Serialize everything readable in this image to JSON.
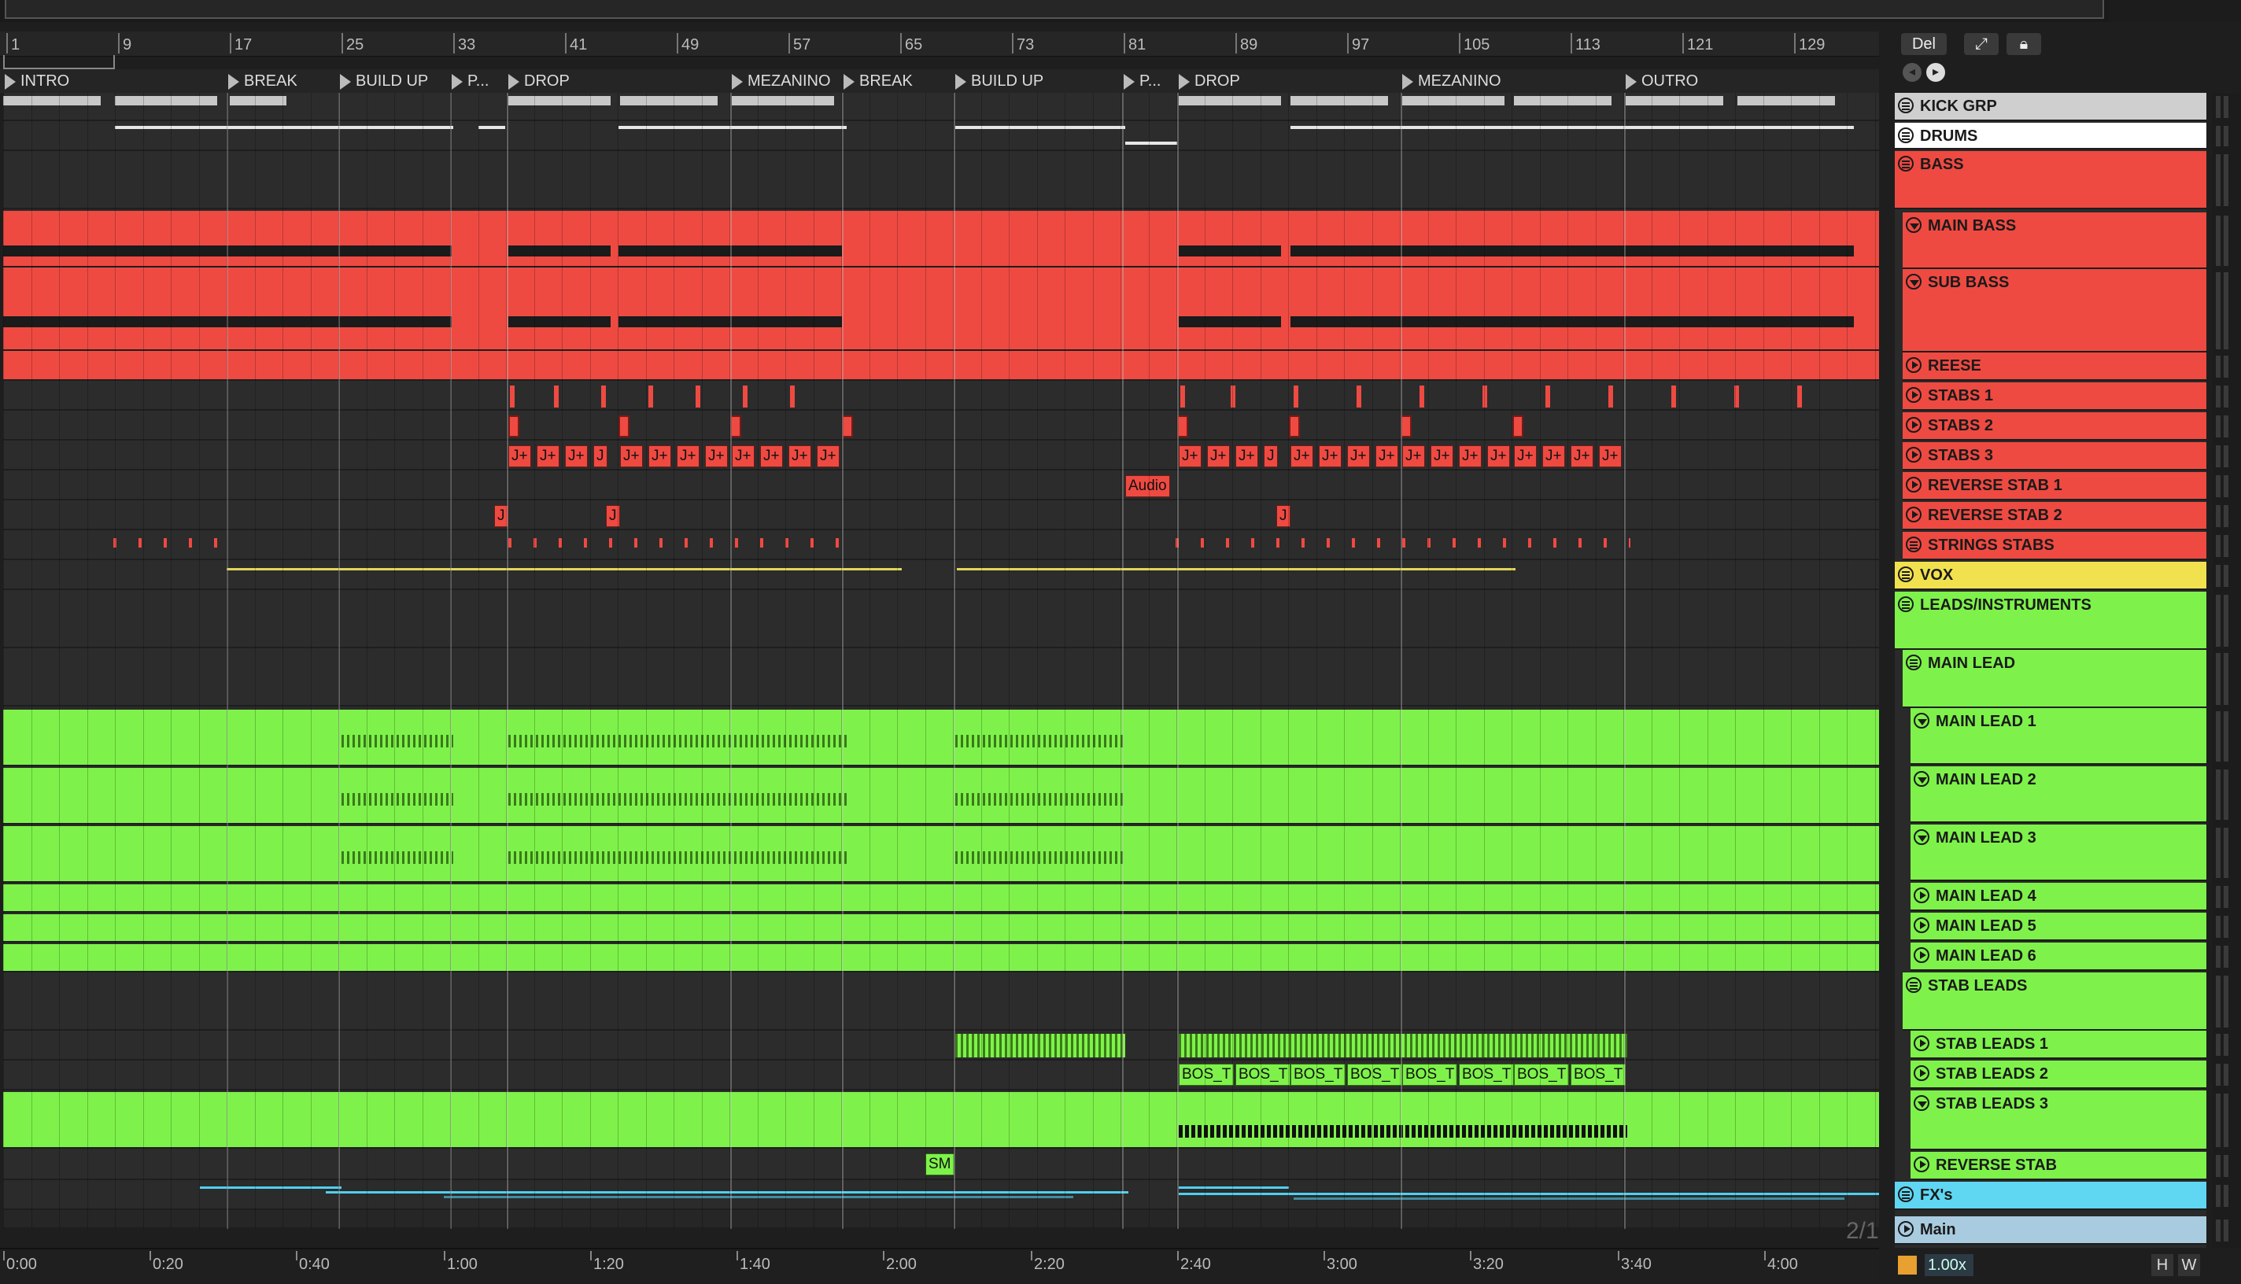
{
  "ruler": {
    "bars": [
      "1",
      "9",
      "17",
      "25",
      "33",
      "41",
      "49",
      "57",
      "65",
      "73",
      "81",
      "89",
      "97",
      "105",
      "113",
      "121",
      "129"
    ]
  },
  "locators": [
    "INTRO",
    "BREAK",
    "BUILD UP",
    "P...",
    "DROP",
    "MEZANINO",
    "BREAK",
    "BUILD UP",
    "P...",
    "DROP",
    "MEZANINO",
    "OUTRO"
  ],
  "time_ruler": [
    "0:00",
    "0:20",
    "0:40",
    "1:00",
    "1:20",
    "1:40",
    "2:00",
    "2:20",
    "2:40",
    "3:00",
    "3:20",
    "3:40",
    "4:00"
  ],
  "page_counter": "2/1",
  "controls": {
    "del_label": "Del",
    "expand_icon": "expand-icon",
    "lock_icon": "lock-icon",
    "zoom_value": "1.00x",
    "h_label": "H",
    "w_label": "W"
  },
  "clip_labels": {
    "audio": "Audio",
    "j": "J",
    "j_plus": "J+",
    "bos": "BOS_T",
    "sm": "SM"
  },
  "tracks": [
    {
      "name": "KICK GRP",
      "color": "#cfcfcf",
      "icon": "fold"
    },
    {
      "name": "DRUMS",
      "color": "#ffffff",
      "icon": "fold"
    },
    {
      "name": "BASS",
      "color": "#ee4a42",
      "icon": "fold"
    },
    {
      "name": "MAIN BASS",
      "color": "#ee4a42",
      "icon": "down"
    },
    {
      "name": "SUB BASS",
      "color": "#ee4a42",
      "icon": "down"
    },
    {
      "name": "REESE",
      "color": "#ee4a42",
      "icon": "play"
    },
    {
      "name": "STABS 1",
      "color": "#ee4a42",
      "icon": "play"
    },
    {
      "name": "STABS 2",
      "color": "#ee4a42",
      "icon": "play"
    },
    {
      "name": "STABS 3",
      "color": "#ee4a42",
      "icon": "play"
    },
    {
      "name": "REVERSE STAB 1",
      "color": "#ee4a42",
      "icon": "play"
    },
    {
      "name": "REVERSE STAB 2",
      "color": "#ee4a42",
      "icon": "play"
    },
    {
      "name": "STRINGS STABS",
      "color": "#ee4a42",
      "icon": "fold"
    },
    {
      "name": "VOX",
      "color": "#f2e14e",
      "icon": "fold"
    },
    {
      "name": "LEADS/INSTRUMENTS",
      "color": "#7ef24a",
      "icon": "fold"
    },
    {
      "name": "MAIN LEAD",
      "color": "#7ef24a",
      "icon": "fold"
    },
    {
      "name": "MAIN LEAD 1",
      "color": "#7ef24a",
      "icon": "down"
    },
    {
      "name": "MAIN LEAD 2",
      "color": "#7ef24a",
      "icon": "down"
    },
    {
      "name": "MAIN LEAD 3",
      "color": "#7ef24a",
      "icon": "down"
    },
    {
      "name": "MAIN LEAD 4",
      "color": "#7ef24a",
      "icon": "play"
    },
    {
      "name": "MAIN LEAD 5",
      "color": "#7ef24a",
      "icon": "play"
    },
    {
      "name": "MAIN LEAD 6",
      "color": "#7ef24a",
      "icon": "play"
    },
    {
      "name": "STAB LEADS",
      "color": "#7ef24a",
      "icon": "fold"
    },
    {
      "name": "STAB LEADS 1",
      "color": "#7ef24a",
      "icon": "play"
    },
    {
      "name": "STAB LEADS 2",
      "color": "#7ef24a",
      "icon": "play"
    },
    {
      "name": "STAB LEADS 3",
      "color": "#7ef24a",
      "icon": "down"
    },
    {
      "name": "REVERSE STAB",
      "color": "#7ef24a",
      "icon": "play"
    },
    {
      "name": "FX's",
      "color": "#5fd6f2",
      "icon": "fold"
    },
    {
      "name": "Main",
      "color": "#a9cbe0",
      "icon": "play"
    }
  ]
}
